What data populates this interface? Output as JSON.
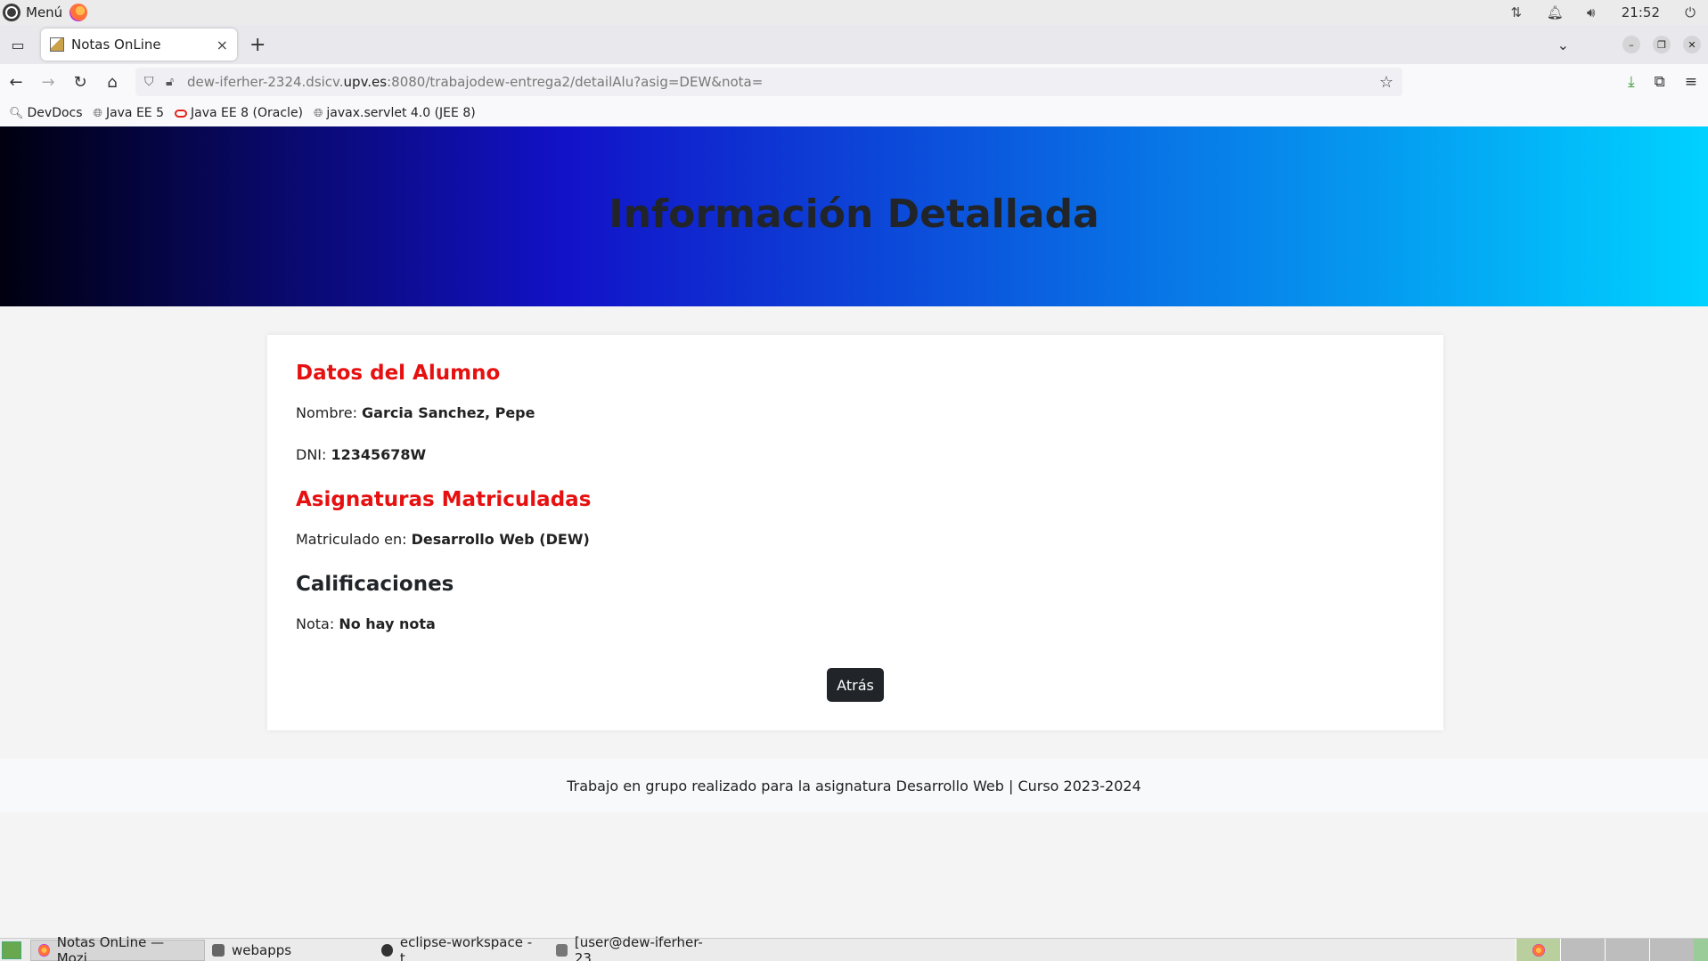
{
  "system_bar": {
    "menu_label": "Menú",
    "clock": "21:52"
  },
  "browser": {
    "tab": {
      "title": "Notas OnLine",
      "close": "×"
    },
    "new_tab": "+",
    "url": {
      "prefix": "dew-iferher-2324.dsicv.",
      "host": "upv.es",
      "path": ":8080/trabajodew-entrega2/detailAlu?asig=DEW&nota="
    },
    "bookmarks": [
      {
        "label": "DevDocs",
        "icon": "search-icon"
      },
      {
        "label": "Java EE 5",
        "icon": "globe-icon"
      },
      {
        "label": "Java EE 8 (Oracle)",
        "icon": "oracle-icon"
      },
      {
        "label": "javax.servlet 4.0 (JEE 8)",
        "icon": "globe-icon"
      }
    ]
  },
  "page": {
    "header_title": "Información Detallada",
    "student_section_title": "Datos del Alumno",
    "name_label": "Nombre: ",
    "name_value": "Garcia Sanchez, Pepe",
    "dni_label": "DNI: ",
    "dni_value": "12345678W",
    "subjects_section_title": "Asignaturas Matriculadas",
    "enrolled_label": "Matriculado en: ",
    "enrolled_value": "Desarrollo Web (DEW)",
    "grades_section_title": "Calificaciones",
    "grade_label": "Nota: ",
    "grade_value": "No hay nota",
    "back_button": "Atrás",
    "footer_text": "Trabajo en grupo realizado para la asignatura Desarrollo Web | Curso 2023-2024"
  },
  "colors": {
    "section_title": "#e61010",
    "header_gradient": [
      "#000010",
      "#1212c8",
      "#0a5fe0",
      "#00d2ff"
    ]
  },
  "taskbar": {
    "items": [
      {
        "label": "Notas OnLine — Mozi...",
        "icon": "firefox-icon"
      },
      {
        "label": "webapps",
        "icon": "folder-icon"
      },
      {
        "label": "eclipse-workspace - t...",
        "icon": "eclipse-icon"
      },
      {
        "label": "[user@dew-iferher-23...",
        "icon": "terminal-icon"
      }
    ]
  }
}
